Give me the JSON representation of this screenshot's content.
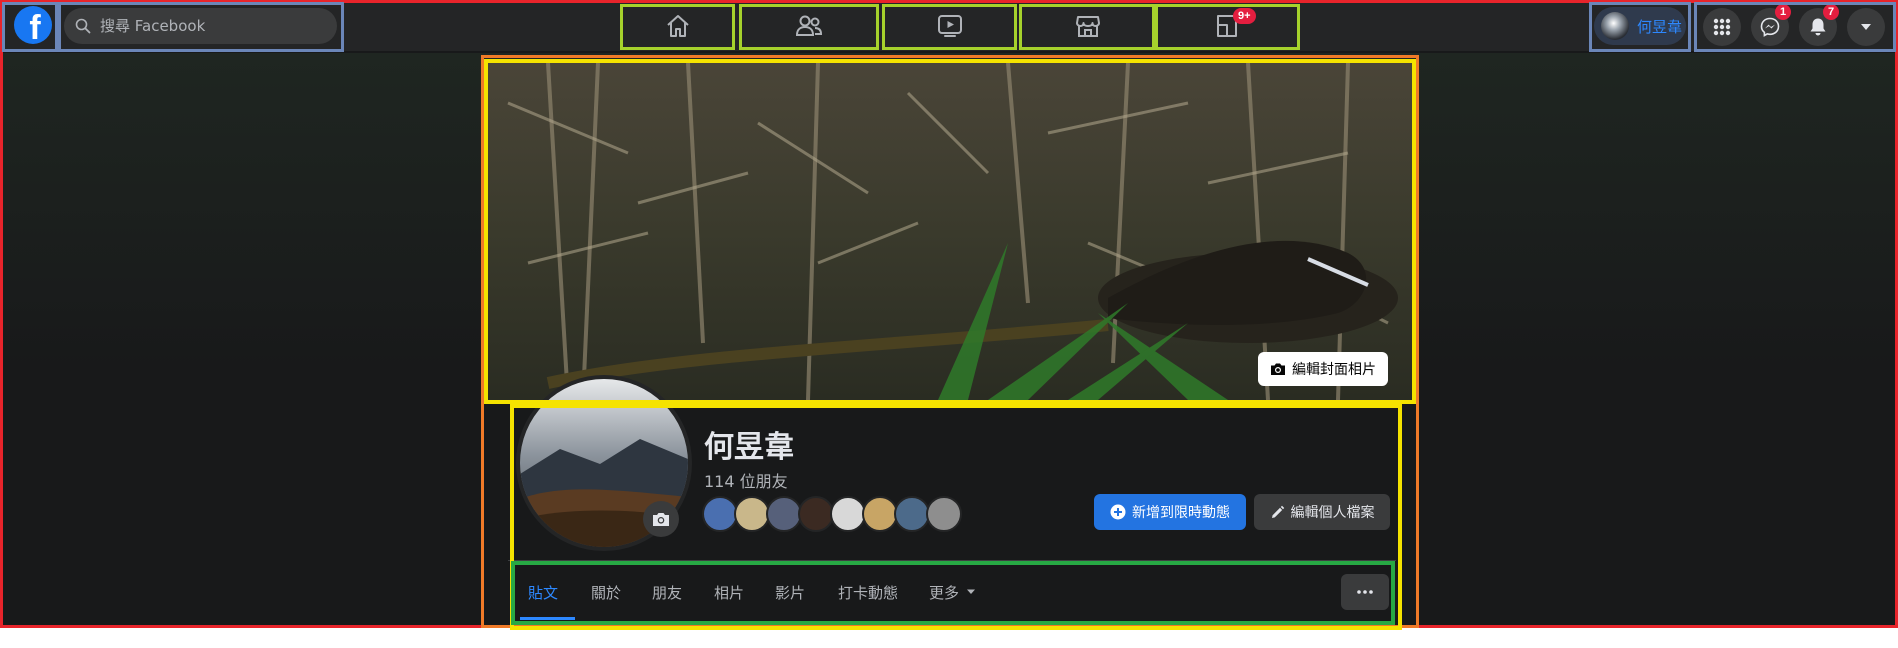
{
  "header": {
    "search": {
      "placeholder": "搜尋 Facebook"
    },
    "nav": [
      {
        "name": "home",
        "icon": "home-icon"
      },
      {
        "name": "friends",
        "icon": "friends-icon"
      },
      {
        "name": "watch",
        "icon": "video-icon"
      },
      {
        "name": "marketplace",
        "icon": "store-icon"
      },
      {
        "name": "gaming",
        "icon": "gaming-icon",
        "badge": "9+"
      }
    ],
    "profile_chip_name": "何昱韋",
    "messenger_badge": "1",
    "notifications_badge": "7"
  },
  "cover": {
    "edit_label": "編輯封面相片"
  },
  "profile": {
    "name": "何昱韋",
    "friends_count": "114 位朋友",
    "add_story_label": "新增到限時動態",
    "edit_profile_label": "編輯個人檔案"
  },
  "tabs": [
    {
      "label": "貼文"
    },
    {
      "label": "關於"
    },
    {
      "label": "朋友"
    },
    {
      "label": "相片"
    },
    {
      "label": "影片"
    },
    {
      "label": "打卡動態"
    },
    {
      "label": "更多"
    }
  ],
  "colors": {
    "accent": "#2d88ff",
    "primary_button": "#2374e1",
    "badge": "#e41e3f",
    "surface": "#242526",
    "background": "#18191a"
  }
}
